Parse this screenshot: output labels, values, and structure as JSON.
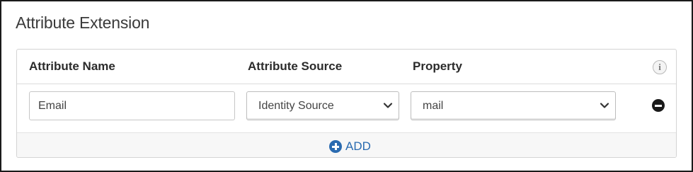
{
  "section": {
    "title": "Attribute Extension"
  },
  "table": {
    "columns": [
      "Attribute Name",
      "Attribute Source",
      "Property"
    ],
    "info_icon_glyph": "i",
    "rows": [
      {
        "attribute_name": "Email",
        "attribute_source": "Identity Source",
        "property": "mail"
      }
    ],
    "add_label": "ADD"
  },
  "icons": {
    "info": "info-icon",
    "remove": "minus-circle-icon",
    "add": "plus-circle-icon",
    "dropdown": "chevron-down-icon"
  },
  "colors": {
    "accent": "#2a6bb0",
    "remove": "#1a1a1a",
    "border": "#d4d4d4"
  }
}
